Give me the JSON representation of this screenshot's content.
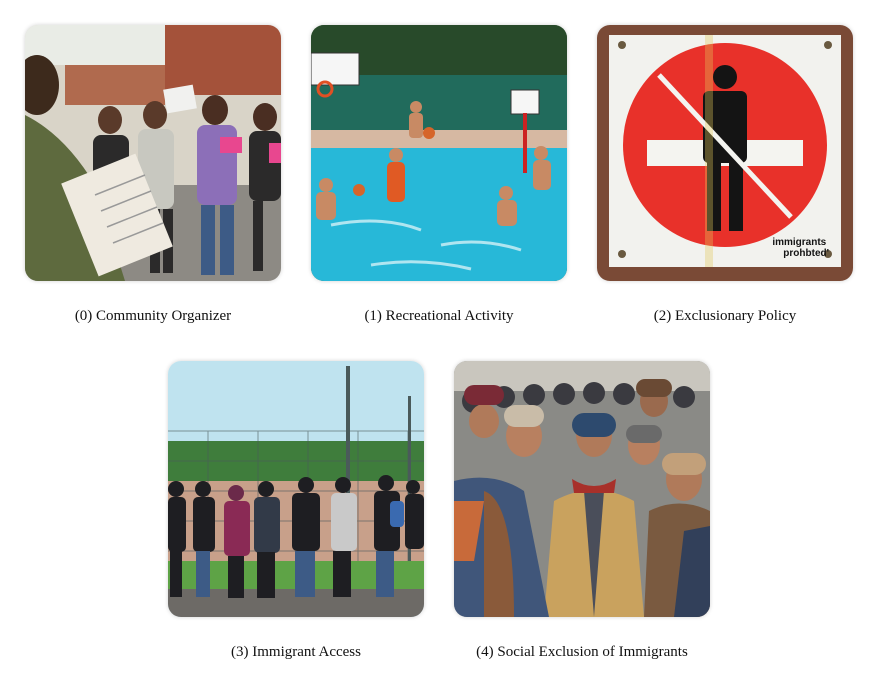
{
  "panels": [
    {
      "caption": "(0) Community Organizer"
    },
    {
      "caption": "(1) Recreational Activity"
    },
    {
      "caption": "(2) Exclusionary Policy",
      "sign_text": "immigrants prohibted'"
    },
    {
      "caption": "(3) Immigrant Access"
    },
    {
      "caption": "(4) Social Exclusion of Immigrants"
    }
  ],
  "colors": {
    "pool": "#27b8d8",
    "sign_red": "#e8312a",
    "sign_board": "#f2f2ee",
    "sky": "#bfe3ef"
  }
}
